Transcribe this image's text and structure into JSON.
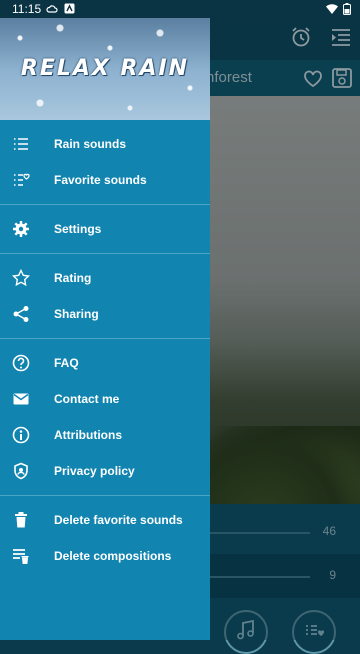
{
  "status_bar": {
    "time": "11:15"
  },
  "app": {
    "title_partial": "nforest",
    "mixer": [
      {
        "value": "46"
      },
      {
        "value": "9"
      }
    ]
  },
  "drawer": {
    "logo_text": "RELAX RAIN",
    "items": [
      {
        "label": "Rain sounds",
        "icon": "list-icon"
      },
      {
        "label": "Favorite sounds",
        "icon": "favorite-list-icon"
      },
      {
        "label": "Settings",
        "icon": "gear-icon"
      },
      {
        "label": "Rating",
        "icon": "star-icon"
      },
      {
        "label": "Sharing",
        "icon": "share-icon"
      },
      {
        "label": "FAQ",
        "icon": "help-icon"
      },
      {
        "label": "Contact me",
        "icon": "mail-icon"
      },
      {
        "label": "Attributions",
        "icon": "info-icon"
      },
      {
        "label": "Privacy policy",
        "icon": "shield-icon"
      },
      {
        "label": "Delete favorite sounds",
        "icon": "trash-icon"
      },
      {
        "label": "Delete compositions",
        "icon": "delete-list-icon"
      }
    ]
  },
  "colors": {
    "drawer": "#1184b0",
    "appbar": "#0d4d64"
  }
}
